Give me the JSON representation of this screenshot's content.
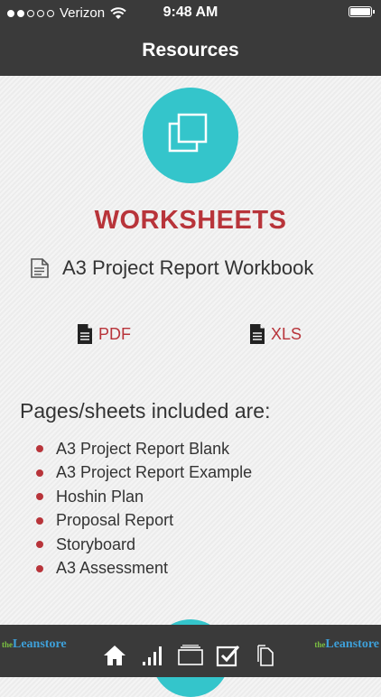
{
  "status": {
    "carrier": "Verizon",
    "time": "9:48 AM",
    "signal_bars": 2,
    "battery_level": 1.0
  },
  "nav": {
    "title": "Resources"
  },
  "section": {
    "title": "WORKSHEETS",
    "icon": "copy-squares-icon"
  },
  "document": {
    "title": "A3 Project Report Workbook",
    "icon": "document-icon"
  },
  "files": [
    {
      "label": "PDF",
      "icon": "file-icon"
    },
    {
      "label": "XLS",
      "icon": "file-icon"
    }
  ],
  "pages": {
    "heading": "Pages/sheets included are:",
    "items": [
      "A3 Project Report Blank",
      "A3 Project Report Example",
      "Hoshin Plan",
      "Proposal Report",
      "Storyboard",
      "A3 Assessment"
    ]
  },
  "branding": {
    "the": "the",
    "name": "Leanstore"
  },
  "tabs": [
    {
      "name": "home-icon"
    },
    {
      "name": "chart-icon"
    },
    {
      "name": "folder-icon"
    },
    {
      "name": "checkbox-icon"
    },
    {
      "name": "documents-icon"
    }
  ],
  "colors": {
    "accent_red": "#b8343a",
    "accent_teal": "#34c5cb",
    "bar_dark": "#3a3a3a"
  }
}
